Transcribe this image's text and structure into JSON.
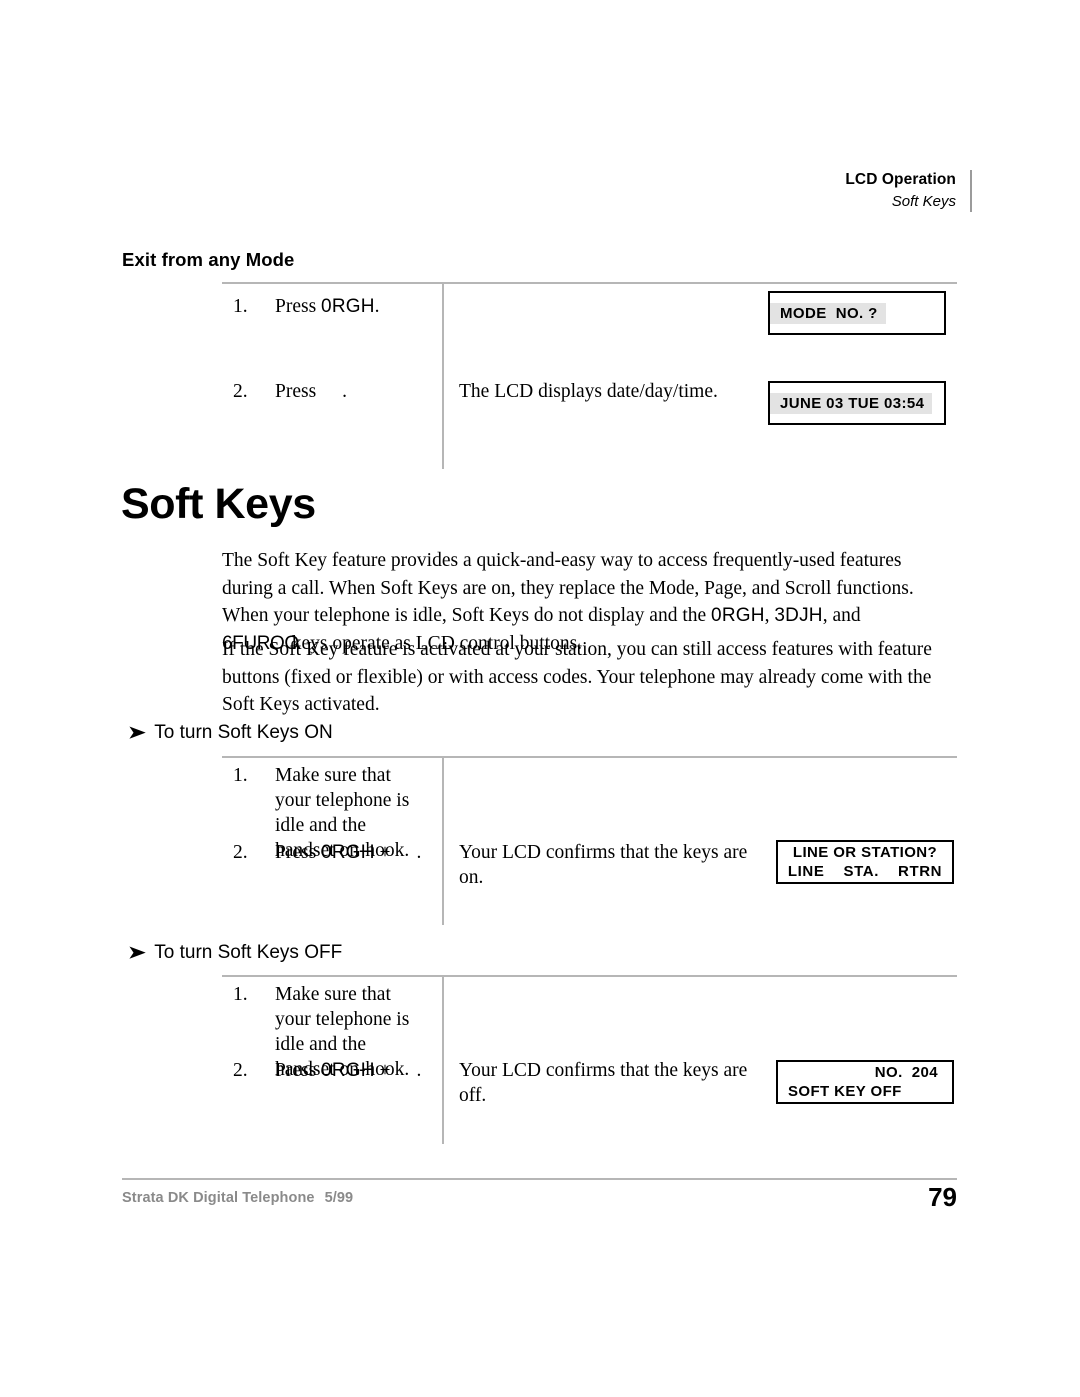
{
  "header": {
    "main": "LCD Operation",
    "sub": "Soft Keys"
  },
  "exit_section": {
    "heading": "Exit from any Mode",
    "steps": [
      {
        "num": "1.",
        "press_label": "Press",
        "key": "0RGH",
        "period": ".",
        "result": ""
      },
      {
        "num": "2.",
        "press_label": "Press",
        "key": "",
        "period": ".",
        "result": "The LCD displays date/day/time."
      }
    ],
    "lcd_1": {
      "line1": "MODE  NO. ?"
    },
    "lcd_2": {
      "line1": "JUNE 03 TUE 03:54"
    }
  },
  "title": "Soft Keys",
  "paragraphs": {
    "p1_a": "The Soft Key feature provides a quick-and-easy way to access frequently-used features during a call. When Soft Keys are on, they replace the Mode, Page, and Scroll functions. When your telephone is idle, Soft Keys do not display and the ",
    "p1_key1": "0RGH",
    "p1_sep1": ", ",
    "p1_key2": "3DJH",
    "p1_sep2": ", and ",
    "p1_key3": "6FUROO",
    "p1_b": "keys operate as LCD control buttons.",
    "p2": "If the Soft Key feature is activated at your station, you can still access features with feature buttons (fixed or flexible) or with access codes. Your telephone may already come with the Soft Keys activated."
  },
  "on_section": {
    "heading": "To turn Soft Keys ON",
    "arrow": "➤",
    "steps": [
      {
        "num": "1.",
        "text": "Make sure that your telephone is idle and the handset on-hook."
      },
      {
        "num": "2.",
        "press_label": "Press",
        "key": "0RGH",
        "plus": "+",
        "period": "."
      }
    ],
    "result": "Your LCD confirms that the keys are on.",
    "lcd": {
      "line1": "LINE OR STATION?",
      "line2": "LINE    STA.    RTRN"
    }
  },
  "off_section": {
    "heading": "To turn Soft Keys OFF",
    "arrow": "➤",
    "steps": [
      {
        "num": "1.",
        "text": "Make sure that your telephone is idle and the handset on-hook."
      },
      {
        "num": "2.",
        "press_label": "Press",
        "key": "0RGH",
        "plus": "+",
        "period": "."
      }
    ],
    "result": "Your LCD confirms that the keys are off.",
    "lcd": {
      "line1": "NO.  204",
      "line2": "SOFT KEY OFF"
    }
  },
  "footer": {
    "doc": "Strata DK Digital Telephone",
    "date": "5/99",
    "page": "79"
  }
}
